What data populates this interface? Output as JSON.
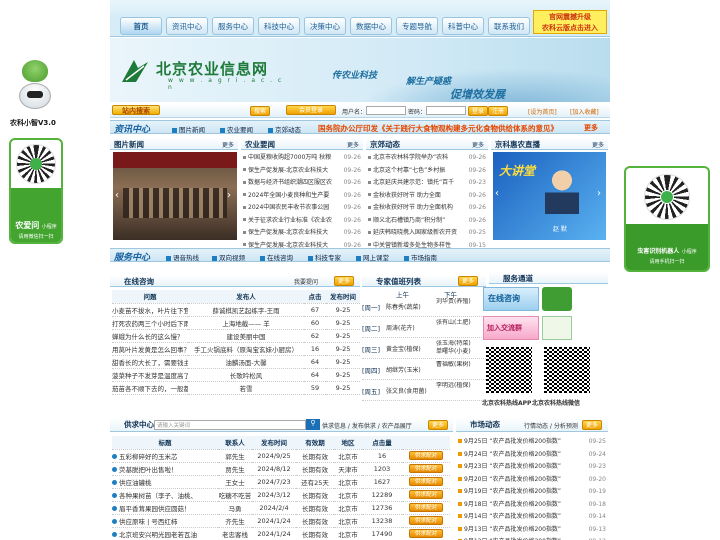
{
  "left_sidebar": {
    "bot_label": "农科小智V3.0",
    "card_title": "农爱问",
    "card_sub": "小程序",
    "card_desc": "请用微信扫一扫"
  },
  "right_sidebar": {
    "card_title": "虫害识别机器人",
    "card_sub": "小程序",
    "card_desc": "请用手机扫一扫"
  },
  "ad": {
    "line1": "官网震撼升级",
    "line2": "农科云版点击进入"
  },
  "nav": [
    "首页",
    "资讯中心",
    "服务中心",
    "科技中心",
    "决策中心",
    "数据中心",
    "专题导航",
    "科普中心",
    "联系我们"
  ],
  "banner": {
    "logo_title": "北京农业信息网",
    "logo_url": "w w w . a g r i . a c . c n",
    "slogan1": "传农业科技",
    "slogan2": "解生产疑惑",
    "slogan3": "促增效发展"
  },
  "login": {
    "site_label": "站内搜索",
    "btn_search": "搜索",
    "btn_member": "会员登录",
    "user_label": "用户名：",
    "pwd_label": "密码：",
    "btn_login": "登录",
    "btn_reg": "注册",
    "set_home": "设为首页",
    "add_fav": "加入收藏"
  },
  "info_center": {
    "title": "资讯中心",
    "links": [
      "图片新闻",
      "农业要闻",
      "京郊动态"
    ],
    "headline": "国务院办公厅印发《关于践行大食物观构建多元化食物供给体系的意见》",
    "more": "更多"
  },
  "photo_news": {
    "title": "图片新闻",
    "more": "更多"
  },
  "agri_news": {
    "title": "农业要闻",
    "more": "更多",
    "items": [
      {
        "t": "中国夏粮收购超7000万吨 秋粮",
        "d": "09-26"
      },
      {
        "t": "保生产促发展-北京农业科技大",
        "d": "09-26"
      },
      {
        "t": "数据与经济书组织潮四区服区农",
        "d": "09-26"
      },
      {
        "t": "2024年全国小麦良种和生产要",
        "d": "09-26"
      },
      {
        "t": "2024中国农民丰收节农事公园",
        "d": "09-26"
      },
      {
        "t": "关于征求农业行业标准《农业农",
        "d": "09-26"
      },
      {
        "t": "保生产促发展-北京农业科技大",
        "d": "09-26"
      },
      {
        "t": "保生产促发展-北京农业科技大",
        "d": "09-26"
      }
    ]
  },
  "jingjiao": {
    "title": "京郊动态",
    "more": "更多",
    "items": [
      {
        "t": "北京市农林科学院举办“农科",
        "d": "09-26"
      },
      {
        "t": "北京这个村靠“七色”乡村振",
        "d": "09-26"
      },
      {
        "t": "北京延庆共建示范：镇托“百千",
        "d": "09-23"
      },
      {
        "t": "金秋收获好时节 助力全面",
        "d": "09-26"
      },
      {
        "t": "金秋收获好时节 助力全面机构",
        "d": "09-26"
      },
      {
        "t": "顺义北石槽镇乃商“积分制”",
        "d": "09-26"
      },
      {
        "t": "延庆韩晓晓携入国家级新农开资",
        "d": "09-25"
      },
      {
        "t": "中关营镇新增多处生物多样性",
        "d": "09-15"
      }
    ]
  },
  "live": {
    "title": "京科惠农直播",
    "more": "更多",
    "name": "赵 默",
    "live_tag": "大讲堂"
  },
  "service": {
    "title": "服务中心",
    "links": [
      "语音热线",
      "双向视频",
      "在线咨询",
      "科技专家",
      "网上课堂",
      "市场指南"
    ]
  },
  "consult": {
    "title": "在线咨询",
    "ask": "我要提问",
    "more": "更多",
    "headers": [
      "问题",
      "发布人",
      "点击",
      "发布时间"
    ],
    "rows": [
      [
        "小麦苗不拔水，叶片往下耷拉，是",
        "薛诚棋凯艺起练字-王雨",
        "67",
        "9-25"
      ],
      [
        "打死农药两三个小时后下雨了，农",
        "上海地截—— 羊",
        "60",
        "9-25"
      ],
      [
        "蝉蛾为什么长的这么慢？（如图）",
        "建设美丽中国",
        "62",
        "9-25"
      ],
      [
        "用莴叶片发黄是怎么回事？（如图",
        "手工火锅底料（原淘宝玄妹小厨房）",
        "16",
        "9-25"
      ],
      [
        "甜香长的大长了，需要钱主吗？多",
        "油麟汤面-大馨",
        "64",
        "9-25"
      ],
      [
        "菠菜种子不发芽是温度高了吗？",
        "长歌吟松风",
        "64",
        "9-25"
      ],
      [
        "茄苗各不顺下去的，一般都",
        "若雪",
        "59",
        "9-25"
      ]
    ]
  },
  "expert": {
    "title": "专家值班列表",
    "more": "更多",
    "am": "上午",
    "pm": "下午",
    "rows": [
      {
        "day": "[周一]",
        "am": "陈春秀(蔬菜)",
        "pm": "刘华贵(养殖)"
      },
      {
        "day": "[周二]",
        "am": "周涛(花卉)",
        "pm": "张有山(土肥)"
      },
      {
        "day": "[周三]",
        "am": "黄金宝(植保)",
        "pm": "张玉海(特菜)\n单曙华(小麦)"
      },
      {
        "day": "[周四]",
        "am": "胡继芳(玉米)",
        "pm": "曹福敏(果树)"
      },
      {
        "day": "[周五]",
        "am": "张文良(食用菌)",
        "pm": "李明远(植保)"
      }
    ]
  },
  "service_channel": {
    "title": "服务通道",
    "qr1": "北京农科热线APP",
    "qr2": "北京农科热线微信",
    "btn1": "在线咨询",
    "btn2": "加入交流群"
  },
  "supply": {
    "title": "供求中心",
    "placeholder": "请输入关键词",
    "links": [
      "供求信息",
      "发布供求",
      "农产品展厅"
    ],
    "more": "更多",
    "headers": [
      "标题",
      "联系人",
      "发布时间",
      "有效期",
      "地区",
      "点击量",
      ""
    ],
    "rows": [
      [
        "五彩柳碎好的玉米芯",
        "郭先生",
        "2024/9/25",
        "长期有效",
        "北京市",
        "16",
        "供求配对"
      ],
      [
        "荧基脱把叶出售啦！",
        "贾先生",
        "2024/8/12",
        "长期有效",
        "天津市",
        "1203",
        "供求配对"
      ],
      [
        "供应油罐桃",
        "王女士",
        "2024/7/23",
        "还有25天",
        "北京市",
        "1627",
        "供求配对"
      ],
      [
        "各种果树苗（李子、油桃、",
        "吃糖不吃苦",
        "2024/3/12",
        "长期有效",
        "北京市",
        "12289",
        "供求配对"
      ],
      [
        "眉平香茸果园供应圆菇！",
        "马勇",
        "2024/2/4",
        "长期有效",
        "北京市",
        "12736",
        "供求配对"
      ],
      [
        "供应原味 | 号西红柿",
        "齐先生",
        "2024/1/24",
        "长期有效",
        "北京市",
        "13238",
        "供求配对"
      ],
      [
        "北京班安兴明光园老若瓦油",
        "老忠客栈",
        "2024/1/24",
        "长期有效",
        "北京市",
        "17490",
        "供求配对"
      ]
    ]
  },
  "market": {
    "title": "市场动态",
    "links": [
      "行情动态",
      "分析预测"
    ],
    "more": "更多",
    "items": [
      {
        "t": "9月25日 “农产品批发价格200指数”",
        "d": "09-25"
      },
      {
        "t": "9月24日 “农产品批发价格200指数”",
        "d": "09-24"
      },
      {
        "t": "9月23日 “农产品批发价格200指数”",
        "d": "09-23"
      },
      {
        "t": "9月20日 “农产品批发价格200指数”",
        "d": "09-20"
      },
      {
        "t": "9月19日 “农产品批发价格200指数”",
        "d": "09-19"
      },
      {
        "t": "9月18日 “农产品批发价格200指数”",
        "d": "09-18"
      },
      {
        "t": "9月14日 “农产品批发价格200指数”",
        "d": "09-14"
      },
      {
        "t": "9月13日 “农产品批发价格200指数”",
        "d": "09-13"
      },
      {
        "t": "9月12日 “农产品批发价格200指数”",
        "d": "09-12"
      }
    ]
  }
}
